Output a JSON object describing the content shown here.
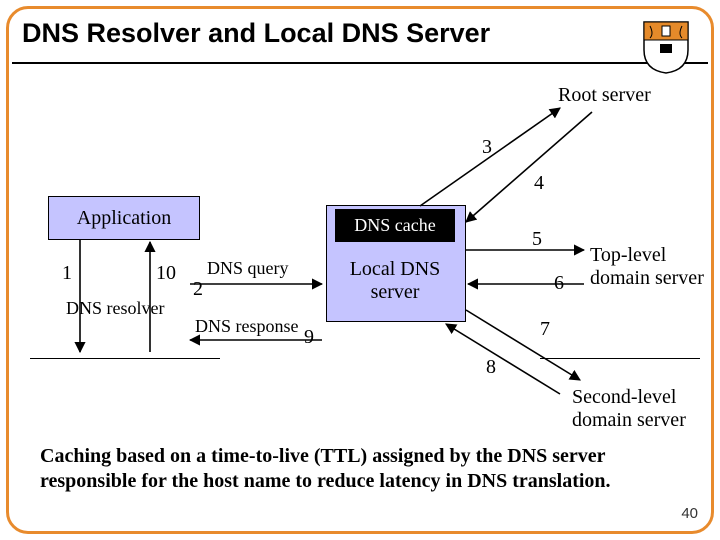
{
  "title": "DNS Resolver and Local DNS Server",
  "nodes": {
    "root": "Root server",
    "application": "Application",
    "dns_cache": "DNS cache",
    "local_dns_line1": "Local DNS",
    "local_dns_line2": "server",
    "dns_resolver": "DNS resolver",
    "tld_line1": "Top-level",
    "tld_line2": "domain server",
    "sld_line1": "Second-level",
    "sld_line2": "domain server"
  },
  "edges": {
    "query": "DNS query",
    "response": "DNS response",
    "n1": "1",
    "n2": "2",
    "n3": "3",
    "n4": "4",
    "n5": "5",
    "n6": "6",
    "n7": "7",
    "n8": "8",
    "n9": "9",
    "n10": "10"
  },
  "footer": "Caching based on a time-to-live (TTL) assigned by the DNS server responsible for the host name to reduce latency in DNS translation.",
  "page": "40"
}
